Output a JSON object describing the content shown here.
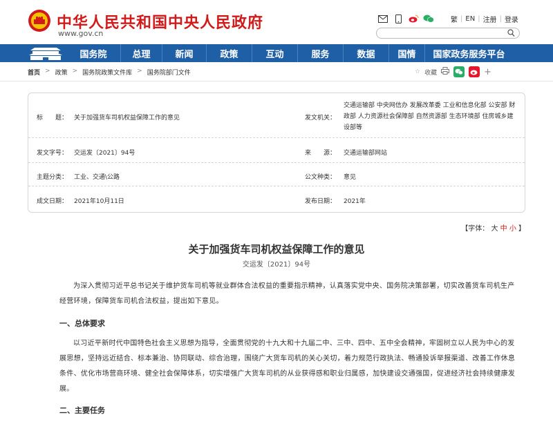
{
  "header": {
    "title": "中华人民共和国中央人民政府",
    "url": "www.gov.cn",
    "links": [
      "繁",
      "EN",
      "注册",
      "登录"
    ],
    "search_placeholder": ""
  },
  "nav": {
    "items": [
      "国务院",
      "总理",
      "新闻",
      "政策",
      "互动",
      "服务",
      "数据",
      "国情",
      "国家政务服务平台"
    ]
  },
  "breadcrumb": [
    "首页",
    "政策",
    "国务院政策文件库",
    "国务院部门文件"
  ],
  "share": {
    "collect": "收藏"
  },
  "info": {
    "title_label": "标　　题：",
    "title_value": "关于加强货车司机权益保障工作的意见",
    "issuer_label": "发文机关：",
    "issuer_value": "交通运输部 中央网信办 发展改革委 工业和信息化部 公安部 财政部 人力资源社会保障部 自然资源部 生态环境部 住房城乡建设部等",
    "docno_label": "发文字号：",
    "docno_value": "交运发〔2021〕94号",
    "source_label": "来　　源：",
    "source_value": "交通运输部网站",
    "topic_label": "主题分类：",
    "topic_value": "工业、交通\\公路",
    "kind_label": "公文种类：",
    "kind_value": "意见",
    "date_label": "成文日期：",
    "date_value": "2021年10月11日",
    "pub_label": "发布日期：",
    "pub_value": "2021年"
  },
  "font_size": {
    "prefix": "【字体：",
    "large": "大",
    "medium": "中",
    "small": "小",
    "suffix": "】"
  },
  "article": {
    "title": "关于加强货车司机权益保障工作的意见",
    "doc_no": "交运发〔2021〕94号",
    "intro": "为深入贯彻习近平总书记关于维护货车司机等就业群体合法权益的重要指示精神，认真落实党中央、国务院决策部署，切实改善货车司机生产经营环境，保障货车司机合法权益，提出如下意见。",
    "h1": "一、总体要求",
    "p1": "以习近平新时代中国特色社会主义思想为指导，全面贯彻党的十九大和十九届二中、三中、四中、五中全会精神，牢固树立以人民为中心的发展思想，坚持远近结合、标本兼治、协同联动、综合治理，围绕广大货车司机的关心关切，着力规范行政执法、畅通投诉举报渠道、改善工作休息条件、优化市场营商环境、健全社会保障体系，切实增强广大货车司机的从业获得感和职业归属感，加快建设交通强国，促进经济社会持续健康发展。",
    "h2": "二、主要任务"
  }
}
